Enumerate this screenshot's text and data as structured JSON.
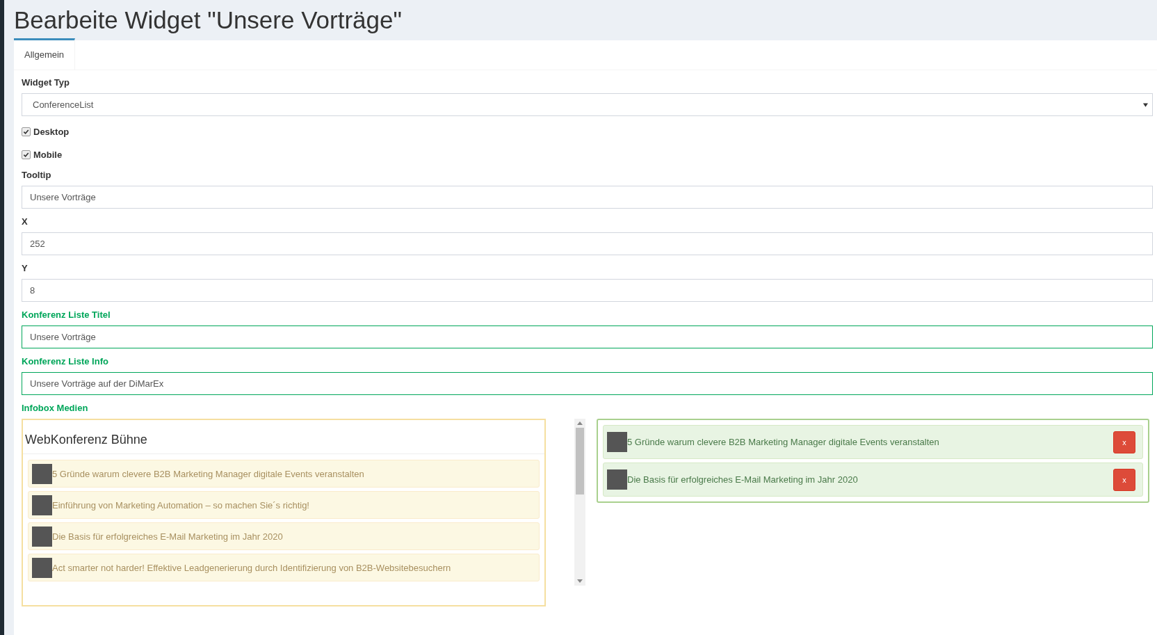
{
  "page_title": "Bearbeite Widget \"Unsere Vorträge\"",
  "tabs": [
    {
      "label": "Allgemein",
      "selected": true
    }
  ],
  "fields": [
    {
      "kind": "select",
      "label": "Widget Typ",
      "value": "ConferenceList",
      "valid": false
    },
    {
      "kind": "checkbox",
      "label": "Desktop",
      "checked": true
    },
    {
      "kind": "checkbox",
      "label": "Mobile",
      "checked": true
    },
    {
      "kind": "text",
      "label": "Tooltip",
      "value": "Unsere Vorträge",
      "valid": false
    },
    {
      "kind": "text",
      "label": "X",
      "value": "252",
      "valid": false
    },
    {
      "kind": "text",
      "label": "Y",
      "value": "8",
      "valid": false
    },
    {
      "kind": "text",
      "label": "Konferenz Liste Titel",
      "value": "Unsere Vorträge",
      "valid": true
    },
    {
      "kind": "text",
      "label": "Konferenz Liste Info",
      "value": "Unsere Vorträge auf der DiMarEx",
      "valid": true
    }
  ],
  "media": {
    "label": "Infobox Medien",
    "valid": true,
    "available": {
      "title": "WebKonferenz Bühne",
      "items": [
        {
          "text": "5 Gründe warum clevere B2B Marketing Manager digitale Events veranstalten"
        },
        {
          "text": "Einführung von Marketing Automation – so machen Sie´s richtig!"
        },
        {
          "text": "Die Basis für erfolgreiches E-Mail Marketing im Jahr 2020"
        },
        {
          "text": "Act smarter not harder! Effektive Leadgenerierung durch Identifizierung von B2B-Websitebesuchern"
        }
      ]
    },
    "selected_items": [
      {
        "text": "5 Gründe warum clevere B2B Marketing Manager digitale Events veranstalten",
        "remove_label": "x"
      },
      {
        "text": "Die Basis für erfolgreiches E-Mail Marketing im Jahr 2020",
        "remove_label": "x"
      }
    ]
  }
}
